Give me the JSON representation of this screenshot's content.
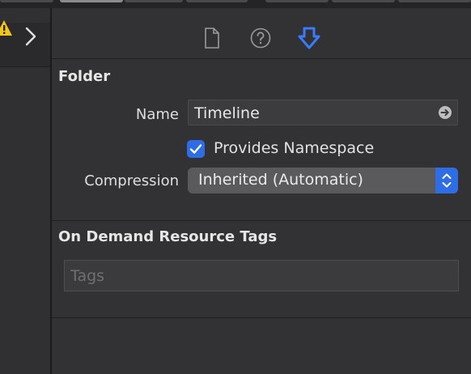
{
  "inspector": {
    "folder_section": {
      "title": "Folder",
      "name_label": "Name",
      "name_value": "Timeline",
      "provides_namespace_label": "Provides Namespace",
      "provides_namespace_checked": true,
      "compression_label": "Compression",
      "compression_value": "Inherited (Automatic)"
    },
    "odr_section": {
      "title": "On Demand Resource Tags",
      "tags_placeholder": "Tags"
    },
    "tabs": [
      {
        "icon": "file-icon",
        "active": false
      },
      {
        "icon": "help-icon",
        "active": false
      },
      {
        "icon": "download-arrow-icon",
        "active": true
      }
    ]
  },
  "navigator": {
    "icons": [
      "warning-icon",
      "chevron-right-icon"
    ]
  },
  "colors": {
    "accent": "#2f6de5",
    "warning": "#f5c518"
  }
}
